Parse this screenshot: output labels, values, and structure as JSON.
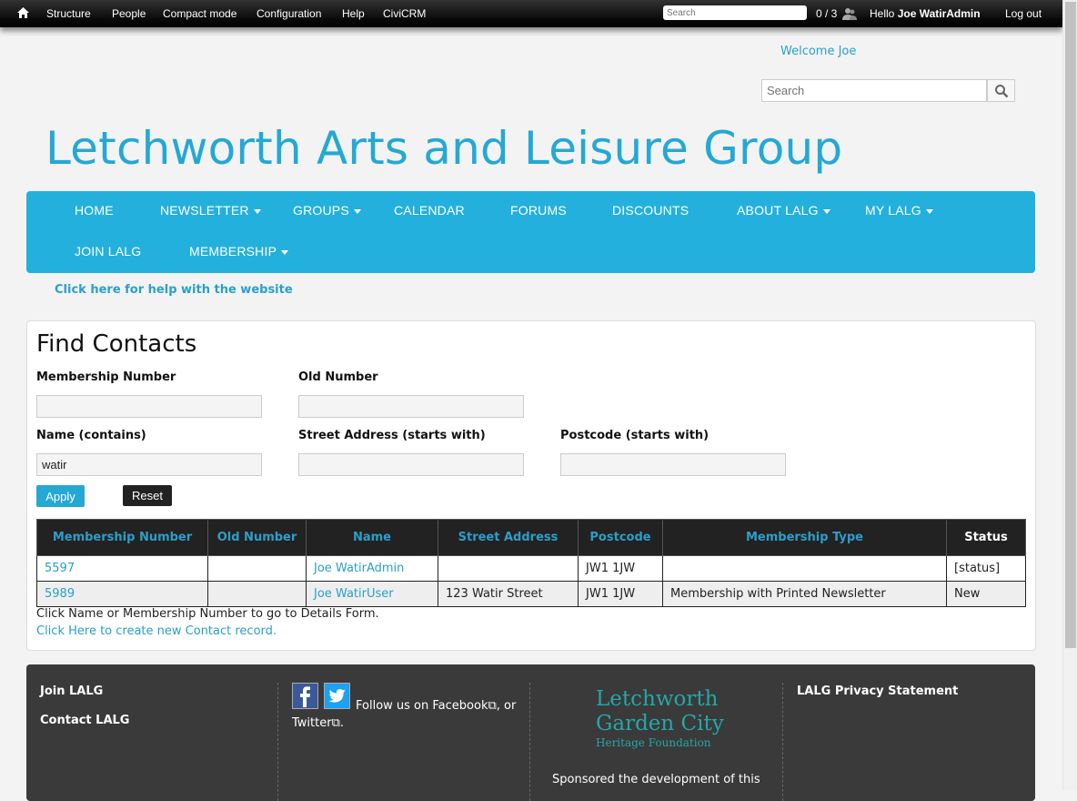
{
  "toolbar": {
    "items": [
      "Structure",
      "People",
      "Compact mode",
      "Configuration",
      "Help",
      "CiviCRM"
    ],
    "search_placeholder": "Search",
    "shortcut_count": "0 / 3",
    "hello_prefix": "Hello",
    "user_name": "Joe WatirAdmin",
    "logout": "Log out"
  },
  "header": {
    "welcome": "Welcome Joe",
    "search_placeholder": "Search",
    "site_title": "Letchworth Arts and Leisure Group"
  },
  "nav": {
    "items": [
      {
        "label": "HOME",
        "dropdown": false
      },
      {
        "label": "NEWSLETTER",
        "dropdown": true
      },
      {
        "label": "GROUPS",
        "dropdown": true
      },
      {
        "label": "CALENDAR",
        "dropdown": false
      },
      {
        "label": "FORUMS",
        "dropdown": false
      },
      {
        "label": "DISCOUNTS",
        "dropdown": false
      },
      {
        "label": "ABOUT LALG",
        "dropdown": true
      },
      {
        "label": "MY LALG",
        "dropdown": true
      },
      {
        "label": "JOIN LALG",
        "dropdown": false
      },
      {
        "label": "MEMBERSHIP",
        "dropdown": true
      }
    ],
    "accent": "#24b0dc"
  },
  "help_link": "Click here for help with the website",
  "find": {
    "title": "Find Contacts",
    "fields": {
      "membership_number": {
        "label": "Membership Number",
        "value": ""
      },
      "old_number": {
        "label": "Old Number",
        "value": ""
      },
      "name": {
        "label": "Name (contains)",
        "value": "watir"
      },
      "street": {
        "label": "Street Address (starts with)",
        "value": ""
      },
      "postcode": {
        "label": "Postcode (starts with)",
        "value": ""
      }
    },
    "apply": "Apply",
    "reset": "Reset",
    "columns": [
      "Membership Number",
      "Old Number",
      "Name",
      "Street Address",
      "Postcode",
      "Membership Type",
      "Status"
    ],
    "rows": [
      {
        "membership_number": "5597",
        "old_number": "",
        "name": "Joe WatirAdmin",
        "street": "",
        "postcode": "JW1 1JW",
        "membership_type": "",
        "status": "[status]"
      },
      {
        "membership_number": "5989",
        "old_number": "",
        "name": "Joe WatirUser",
        "street": "123 Watir Street",
        "postcode": "JW1 1JW",
        "membership_type": "Membership with Printed Newsletter",
        "status": "New"
      }
    ],
    "note": "Click Name or Membership Number to go to Details Form.",
    "create_link": "Click Here to create new Contact record."
  },
  "footer": {
    "join": "Join LALG",
    "contact": "Contact LALG",
    "follow_text": "Follow us on",
    "facebook": "Facebook",
    "or_text": ", or",
    "twitter": "Twitter",
    "period": ".",
    "heritage_line1": "Letchworth",
    "heritage_line2": "Garden City",
    "heritage_line3": "Heritage Foundation",
    "sponsored": "Sponsored the development of this",
    "privacy": "LALG Privacy Statement"
  }
}
